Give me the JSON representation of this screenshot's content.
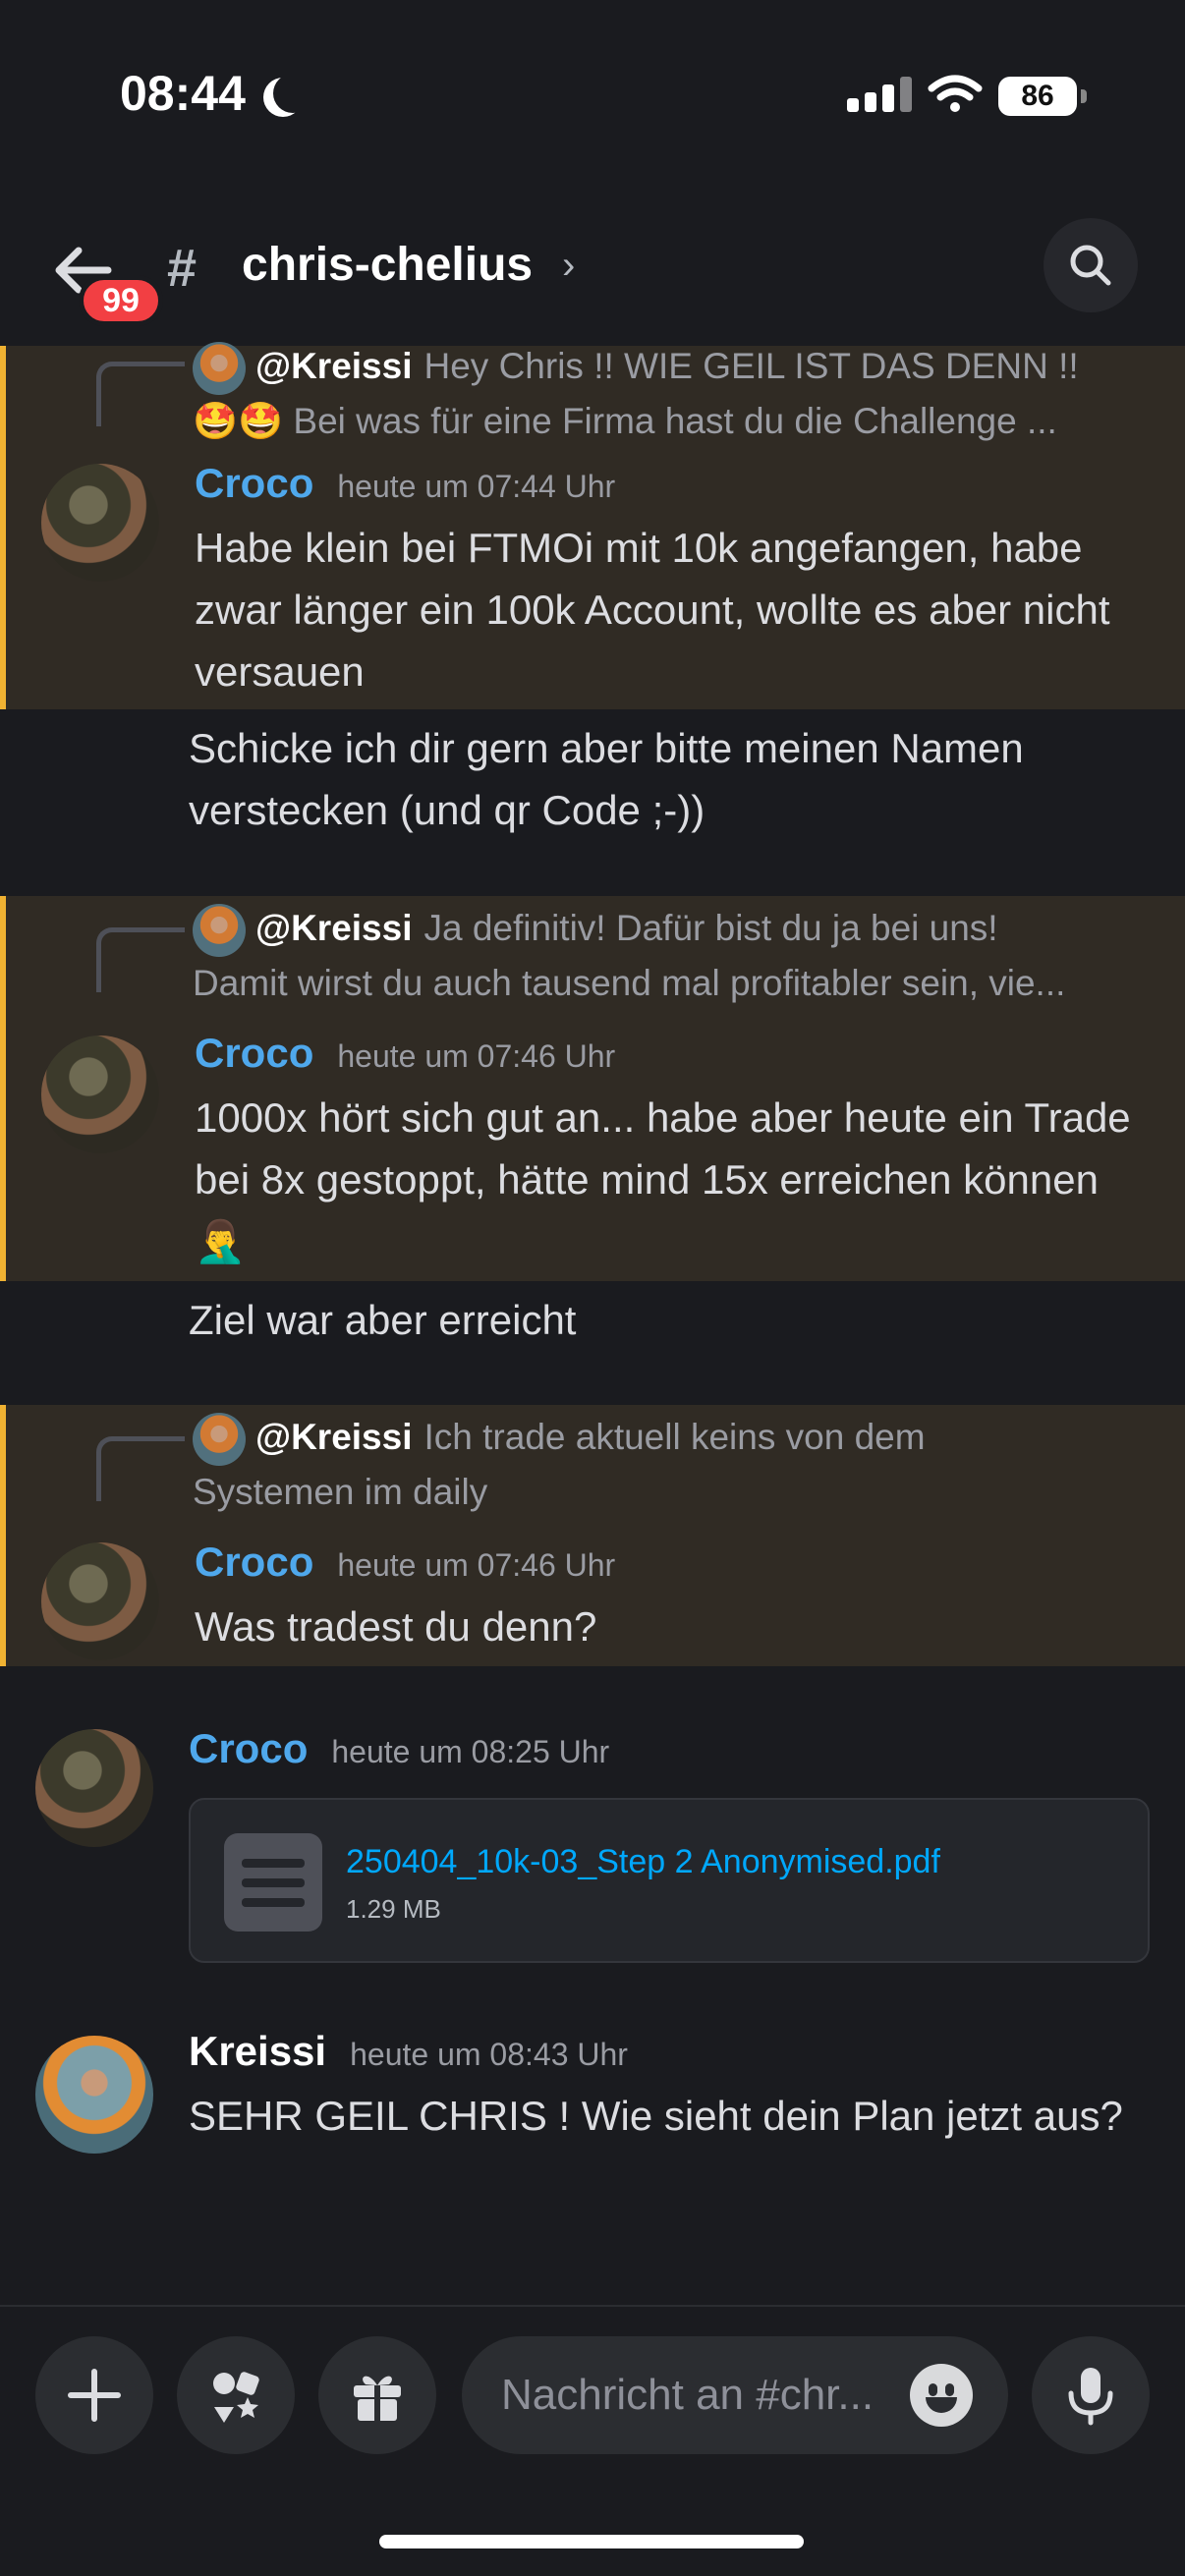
{
  "status": {
    "time": "08:44",
    "battery": "86"
  },
  "header": {
    "unread_badge": "99",
    "channel_name": "chris-chelius",
    "chevron": "›"
  },
  "messages": [
    {
      "reply_to": {
        "name": "@Kreissi",
        "line1": "Hey Chris !! WIE GEIL IST DAS DENN !!",
        "line2": "🤩🤩 Bei was für eine Firma hast du die Challenge ..."
      },
      "author": "Croco",
      "timestamp": "heute um 07:44 Uhr",
      "text": "Habe klein bei FTMOi mit 10k angefangen, habe zwar länger ein 100k Account, wollte es aber nicht versauen",
      "followup": "Schicke ich dir gern aber bitte meinen Namen verstecken (und qr Code ;-))"
    },
    {
      "reply_to": {
        "name": "@Kreissi",
        "line1": "Ja definitiv! Dafür bist du ja bei uns!",
        "line2": "Damit wirst du auch tausend mal profitabler sein, vie..."
      },
      "author": "Croco",
      "timestamp": "heute um 07:46 Uhr",
      "text": "1000x hört sich gut an... habe aber heute ein Trade bei 8x gestoppt, hätte mind 15x erreichen können 🤦‍♂️",
      "followup": "Ziel war aber erreicht"
    },
    {
      "reply_to": {
        "name": "@Kreissi",
        "line1": "Ich trade aktuell keins von dem",
        "line2": "Systemen im daily"
      },
      "author": "Croco",
      "timestamp": "heute um 07:46 Uhr",
      "text": "Was tradest du denn?"
    },
    {
      "author": "Croco",
      "timestamp": "heute um 08:25 Uhr",
      "attachment": {
        "filename": "250404_10k-03_Step 2 Anonymised.pdf",
        "size": "1.29 MB"
      }
    },
    {
      "author": "Kreissi",
      "timestamp": "heute um 08:43 Uhr",
      "text": "SEHR GEIL CHRIS ! Wie sieht dein Plan jetzt aus?"
    }
  ],
  "composer": {
    "placeholder": "Nachricht an #chr..."
  },
  "colors": {
    "accent_blue": "#4fa8ec",
    "highlight_bg": "#302b24",
    "highlight_bar": "#f0b232",
    "badge_red": "#f23f43",
    "link": "#00a8fc"
  }
}
